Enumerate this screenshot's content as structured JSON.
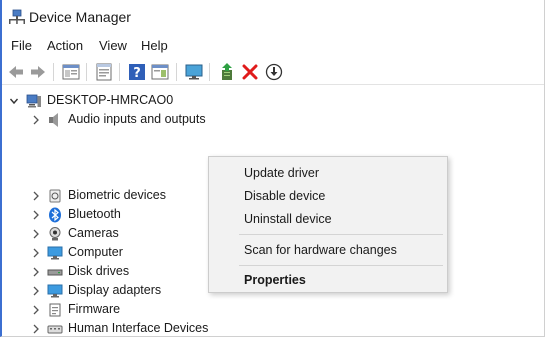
{
  "window": {
    "title": "Device Manager"
  },
  "menubar": {
    "items": [
      "File",
      "Action",
      "View",
      "Help"
    ]
  },
  "toolbar": {
    "buttons": [
      "back-icon",
      "forward-icon",
      "show-hide-console-tree-icon",
      "properties-icon",
      "help-icon",
      "action-pane-icon",
      "monitor-icon",
      "update-driver-icon",
      "uninstall-icon",
      "download-icon"
    ]
  },
  "tree": {
    "root": "DESKTOP-HMRCAO0",
    "items": [
      "Audio inputs and outputs",
      "Biometric devices",
      "Bluetooth",
      "Cameras",
      "Computer",
      "Disk drives",
      "Display adapters",
      "Firmware",
      "Human Interface Devices"
    ]
  },
  "context_menu": {
    "items": [
      "Update driver",
      "Disable device",
      "Uninstall device",
      "Scan for hardware changes",
      "Properties"
    ]
  },
  "colors": {
    "accent": "#3c6fd1",
    "menu_bg": "#f2f2f2",
    "uninstall_red": "#e01b1b"
  }
}
